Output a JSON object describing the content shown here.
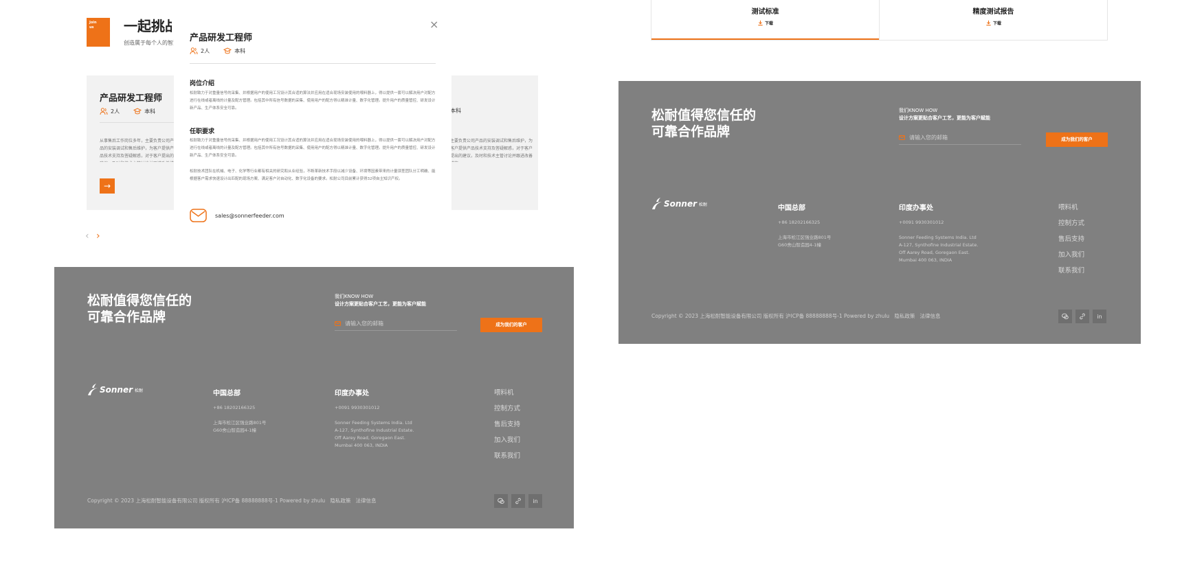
{
  "join": {
    "badge_line1": "Join",
    "badge_line2": "us",
    "title": "一起挑战",
    "subtitle": "创造属于每个人的智慧"
  },
  "job_card": {
    "title": "产品研发工程师",
    "headcount": "2人",
    "education": "本科",
    "description": "从事售后工作岗位多年，主要负责公司产品的安装调试和售后维护，为客户提供产品技术支持及答疑解惑，对于客户提出的建议，及时和技术主管讨论并跟进改善措施。",
    "right_education": "本科",
    "right_description": "主要负责公司产品的安装调试和售后维护，为客户提供产品技术支持及答疑解惑，对于客户提出的建议，及时和技术主管讨论并跟进改善措施。",
    "arrow": "→"
  },
  "pager": {
    "prev": "‹",
    "next": "›"
  },
  "modal": {
    "close": "×",
    "title": "产品研发工程师",
    "headcount": "2人",
    "education": "本科",
    "intro_heading": "岗位介绍",
    "intro_text": "松耐致力于对重量信号的采集、并根据用户的使用工况设计其合适的算法并应用在适合现场安装使用的喂料器上，得以提供一套可以解决用户对配方进行在线或者离线的计量及配方管理。包括其中所有信号数据的采集、使用用户的配方得以精准计量、数字化管理。提升用户的质量管控、研发设计新产品、生产体系安全可靠。",
    "req_heading": "任职要求",
    "req_text": "松耐致力于对重量信号的采集、并根据用户的使用工况设计其合适的算法并应用在适合现场安装使用的喂料器上，得以提供一套可以解决用户对配方进行在线或者离线的计量及配方管理。包括其中所有信号数据的采集、使用用户的配方得以精准计量、数字化管理。提升用户的质量管控、研发设计新产品、生产体系安全可靠。",
    "extra_text": "松耐技术团队在机械、电子、化学等行业都有相关的研究和从业经验，不断革新技术手段以减少设备、环境等因素带来的计量误差团队分工明确、能根据客户需求快速设计出匹配的现场方案、满足客户对自动化、数字化设备的要求。松耐公司目前累计获得32项自主知识产权。",
    "email": "sales@sonnerfeeder.com"
  },
  "tabs": [
    {
      "label": "测试标准",
      "download": "下载"
    },
    {
      "label": "精度测试报告",
      "download": "下载"
    }
  ],
  "footer": {
    "brand_line1": "松耐值得您信任的",
    "brand_line2": "可靠合作品牌",
    "knowhow_line1": "我们KNOW HOW",
    "knowhow_line2": "设计方案更贴合客户工艺，更能为客户赋能",
    "email_placeholder": "请输入您的邮箱",
    "cta": "成为我们的客户",
    "logo_word": "Sonner",
    "logo_zh": "松耐",
    "hq_heading": "中国总部",
    "hq_phone": "+86 18202166325",
    "hq_addr1": "上海市松江区强业路801号",
    "hq_addr2": "G60舍山智造园4-1幢",
    "india_heading": "印度办事处",
    "india_phone": "+0091 9930301012",
    "india_addr1": "Sonner Feeding Systems India. Ltd",
    "india_addr2": "A-127, Synthofine Industrial Estate.",
    "india_addr3": "Off Aarey Road, Goregaon East.",
    "india_addr4": "Mumbai 400 063, INDIA",
    "nav": [
      "喂料机",
      "控制方式",
      "售后支持",
      "加入我们",
      "联系我们"
    ],
    "copyright": "Copyright © 2023 上海松耐智能设备有限公司 版权所有 沪ICP备 88888888号-1 Powered by zhulu",
    "privacy": "隐私政策",
    "legal": "法律信息",
    "social_in": "in"
  }
}
